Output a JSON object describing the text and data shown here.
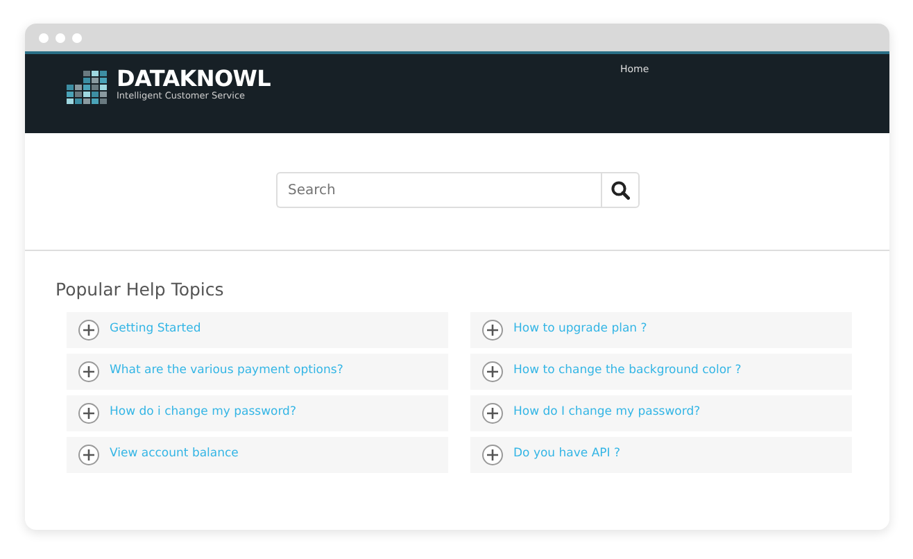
{
  "brand": {
    "name": "DATAKNOWL",
    "tagline": "Intelligent Customer Service"
  },
  "nav": [
    {
      "label": "Home"
    }
  ],
  "search": {
    "placeholder": "Search"
  },
  "help_topics": {
    "title": "Popular Help Topics",
    "columns": [
      [
        "Getting Started",
        "What are the various payment options?",
        "How do i change my password?",
        "View account balance"
      ],
      [
        "How to upgrade plan ?",
        "How to change the background color ?",
        "How do I change my password?",
        "Do you have API ?"
      ]
    ]
  }
}
